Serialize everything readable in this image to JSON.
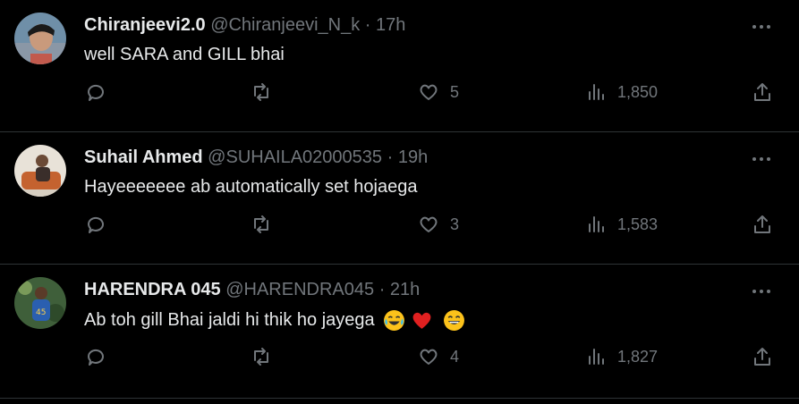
{
  "replies": [
    {
      "name": "Chiranjeevi2.0",
      "handle": "@Chiranjeevi_N_k",
      "dot": "·",
      "time": "17h",
      "text": "well SARA and GILL bhai",
      "likes": "5",
      "views": "1,850"
    },
    {
      "name": "Suhail Ahmed",
      "handle": "@SUHAILA02000535",
      "dot": "·",
      "time": "19h",
      "text": "Hayeeeeeee ab automatically set hojaega",
      "likes": "3",
      "views": "1,583"
    },
    {
      "name": "HARENDRA 045",
      "handle": "@HARENDRA045",
      "dot": "·",
      "time": "21h",
      "text": "Ab toh gill Bhai jaldi hi thik ho jayega",
      "likes": "4",
      "views": "1,827",
      "emojis": [
        "crying-laughing-emoji",
        "red-heart-emoji",
        "grinning-emoji"
      ]
    }
  ],
  "colors": {
    "background": "#000000",
    "text": "#e7e9ea",
    "muted": "#71767b",
    "divider": "#2f3336"
  }
}
